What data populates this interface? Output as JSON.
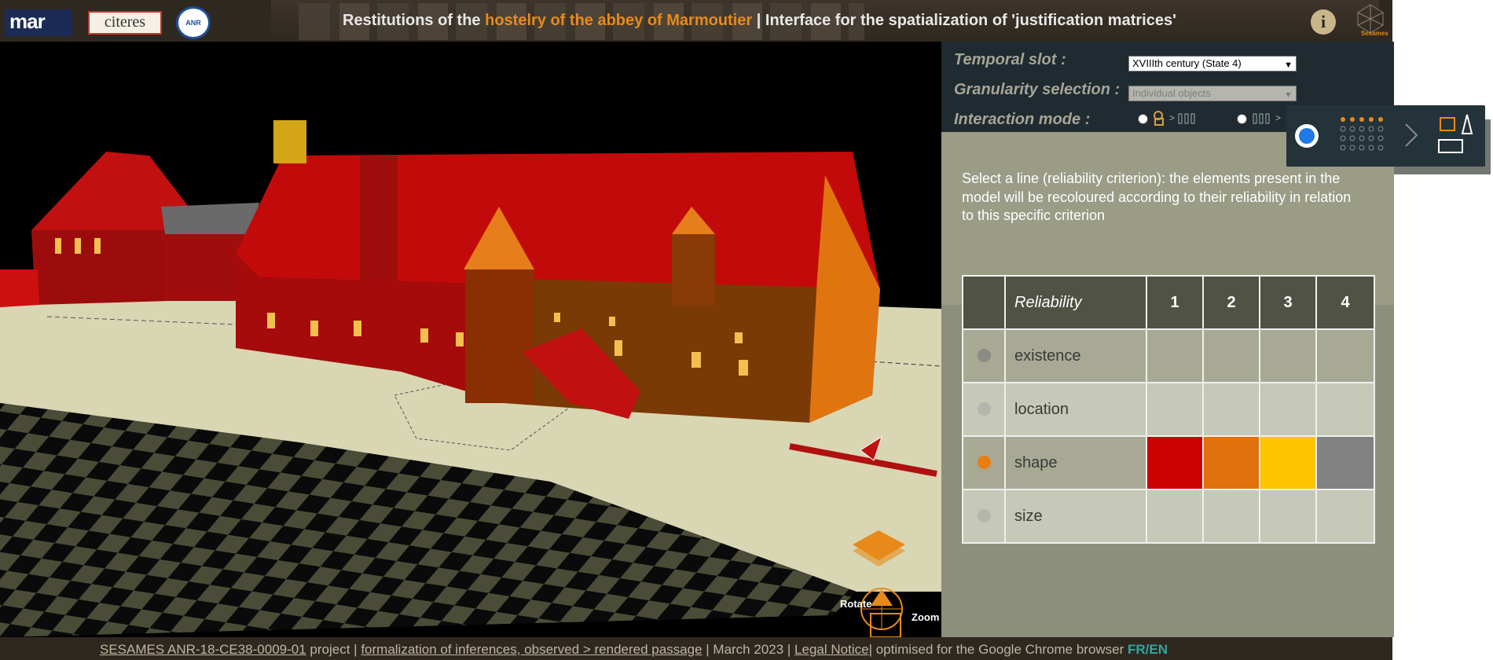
{
  "header": {
    "title_prefix": "Restitutions of the ",
    "title_highlight": "hostelry of the abbey of Marmoutier",
    "title_suffix": " | Interface for the spatialization of 'justification matrices'",
    "logos": {
      "mar": "mar",
      "citeres": "citeres",
      "anr": "ANR",
      "sesames": "Sesames"
    },
    "info_button": "i"
  },
  "viewport": {
    "rotate_label": "Rotate",
    "zoom_label": "Zoom"
  },
  "controls": {
    "temporal_label": "Temporal slot :",
    "temporal_value": "XVIIIth century (State 4)",
    "granularity_label": "Granularity selection :",
    "granularity_value": "Individual objects",
    "interaction_label": "Interaction mode :"
  },
  "instructions": "Select a line (reliability criterion): the elements present in the model will be recoloured according to their reliability in relation to this specific criterion",
  "table": {
    "header": "Reliability",
    "levels": [
      "1",
      "2",
      "3",
      "4"
    ],
    "rows": [
      {
        "name": "existence",
        "active": false
      },
      {
        "name": "location",
        "active": false
      },
      {
        "name": "shape",
        "active": true
      },
      {
        "name": "size",
        "active": false
      }
    ],
    "shape_colors": [
      "#cc0000",
      "#e0720e",
      "#ffc400",
      "#828282"
    ],
    "active_color": "#e87d12"
  },
  "footer": {
    "project_link": "SESAMES ANR-18-CE38-0009-01",
    "project_text": " project | ",
    "formalization_link": "formalization of inferences, observed > rendered passage",
    "date_text": " | March 2023 | ",
    "legal_link": "Legal Notice",
    "browser_text": "| optimised for the Google Chrome browser ",
    "lang": "FR/EN"
  }
}
